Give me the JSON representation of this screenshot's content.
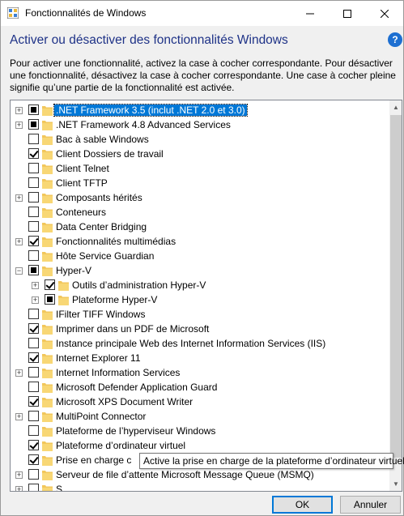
{
  "window": {
    "title": "Fonctionnalités de Windows",
    "heading": "Activer ou désactiver des fonctionnalités Windows",
    "description": "Pour activer une fonctionnalité, activez la case à cocher correspondante. Pour désactiver une fonctionnalité, désactivez la case à cocher correspondante. Une case à cocher pleine signifie qu’une partie de la fonctionnalité est activée."
  },
  "features": [
    {
      "label": ".NET Framework 3.5 (inclut .NET 2.0 et 3.0)",
      "state": "partial",
      "expandable": true,
      "level": 0,
      "selected": true
    },
    {
      "label": ".NET Framework 4.8 Advanced Services",
      "state": "partial",
      "expandable": true,
      "level": 0
    },
    {
      "label": "Bac à sable Windows",
      "state": "unchecked",
      "expandable": false,
      "level": 0
    },
    {
      "label": "Client Dossiers de travail",
      "state": "checked",
      "expandable": false,
      "level": 0
    },
    {
      "label": "Client Telnet",
      "state": "unchecked",
      "expandable": false,
      "level": 0
    },
    {
      "label": "Client TFTP",
      "state": "unchecked",
      "expandable": false,
      "level": 0
    },
    {
      "label": "Composants hérités",
      "state": "unchecked",
      "expandable": true,
      "level": 0
    },
    {
      "label": "Conteneurs",
      "state": "unchecked",
      "expandable": false,
      "level": 0
    },
    {
      "label": "Data Center Bridging",
      "state": "unchecked",
      "expandable": false,
      "level": 0
    },
    {
      "label": "Fonctionnalités multimédias",
      "state": "checked",
      "expandable": true,
      "level": 0
    },
    {
      "label": "Hôte Service Guardian",
      "state": "unchecked",
      "expandable": false,
      "level": 0
    },
    {
      "label": "Hyper-V",
      "state": "partial",
      "expandable": true,
      "expanded": true,
      "level": 0
    },
    {
      "label": "Outils d’administration Hyper-V",
      "state": "checked",
      "expandable": true,
      "level": 1
    },
    {
      "label": "Plateforme Hyper-V",
      "state": "partial",
      "expandable": true,
      "level": 1
    },
    {
      "label": "IFilter TIFF Windows",
      "state": "unchecked",
      "expandable": false,
      "level": 0
    },
    {
      "label": "Imprimer dans un PDF de Microsoft",
      "state": "checked",
      "expandable": false,
      "level": 0
    },
    {
      "label": "Instance principale Web des Internet Information Services (IIS)",
      "state": "unchecked",
      "expandable": false,
      "level": 0
    },
    {
      "label": "Internet Explorer 11",
      "state": "checked",
      "expandable": false,
      "level": 0
    },
    {
      "label": "Internet Information Services",
      "state": "unchecked",
      "expandable": true,
      "level": 0
    },
    {
      "label": "Microsoft Defender Application Guard",
      "state": "unchecked",
      "expandable": false,
      "level": 0
    },
    {
      "label": "Microsoft XPS Document Writer",
      "state": "checked",
      "expandable": false,
      "level": 0
    },
    {
      "label": "MultiPoint Connector",
      "state": "unchecked",
      "expandable": true,
      "level": 0
    },
    {
      "label": "Plateforme de l’hyperviseur Windows",
      "state": "unchecked",
      "expandable": false,
      "level": 0
    },
    {
      "label": "Plateforme d’ordinateur virtuel",
      "state": "checked",
      "expandable": false,
      "level": 0
    },
    {
      "label": "Prise en charge c",
      "state": "checked",
      "expandable": false,
      "level": 0
    },
    {
      "label": "Serveur de file d’attente Microsoft Message Queue (MSMQ)",
      "state": "unchecked",
      "expandable": true,
      "level": 0
    },
    {
      "label": "S",
      "state": "unchecked",
      "expandable": true,
      "level": 0
    }
  ],
  "tooltip": {
    "text": "Active la prise en charge de la plateforme d’ordinateur virtuel"
  },
  "buttons": {
    "ok": "OK",
    "cancel": "Annuler"
  },
  "icons": {
    "title": "windows-features-icon",
    "help": "help-icon",
    "folder": "folder-icon"
  },
  "colors": {
    "heading": "#1e3287",
    "selection": "#0078d7",
    "folder": "#f2c75c",
    "help": "#1d6fd1"
  }
}
